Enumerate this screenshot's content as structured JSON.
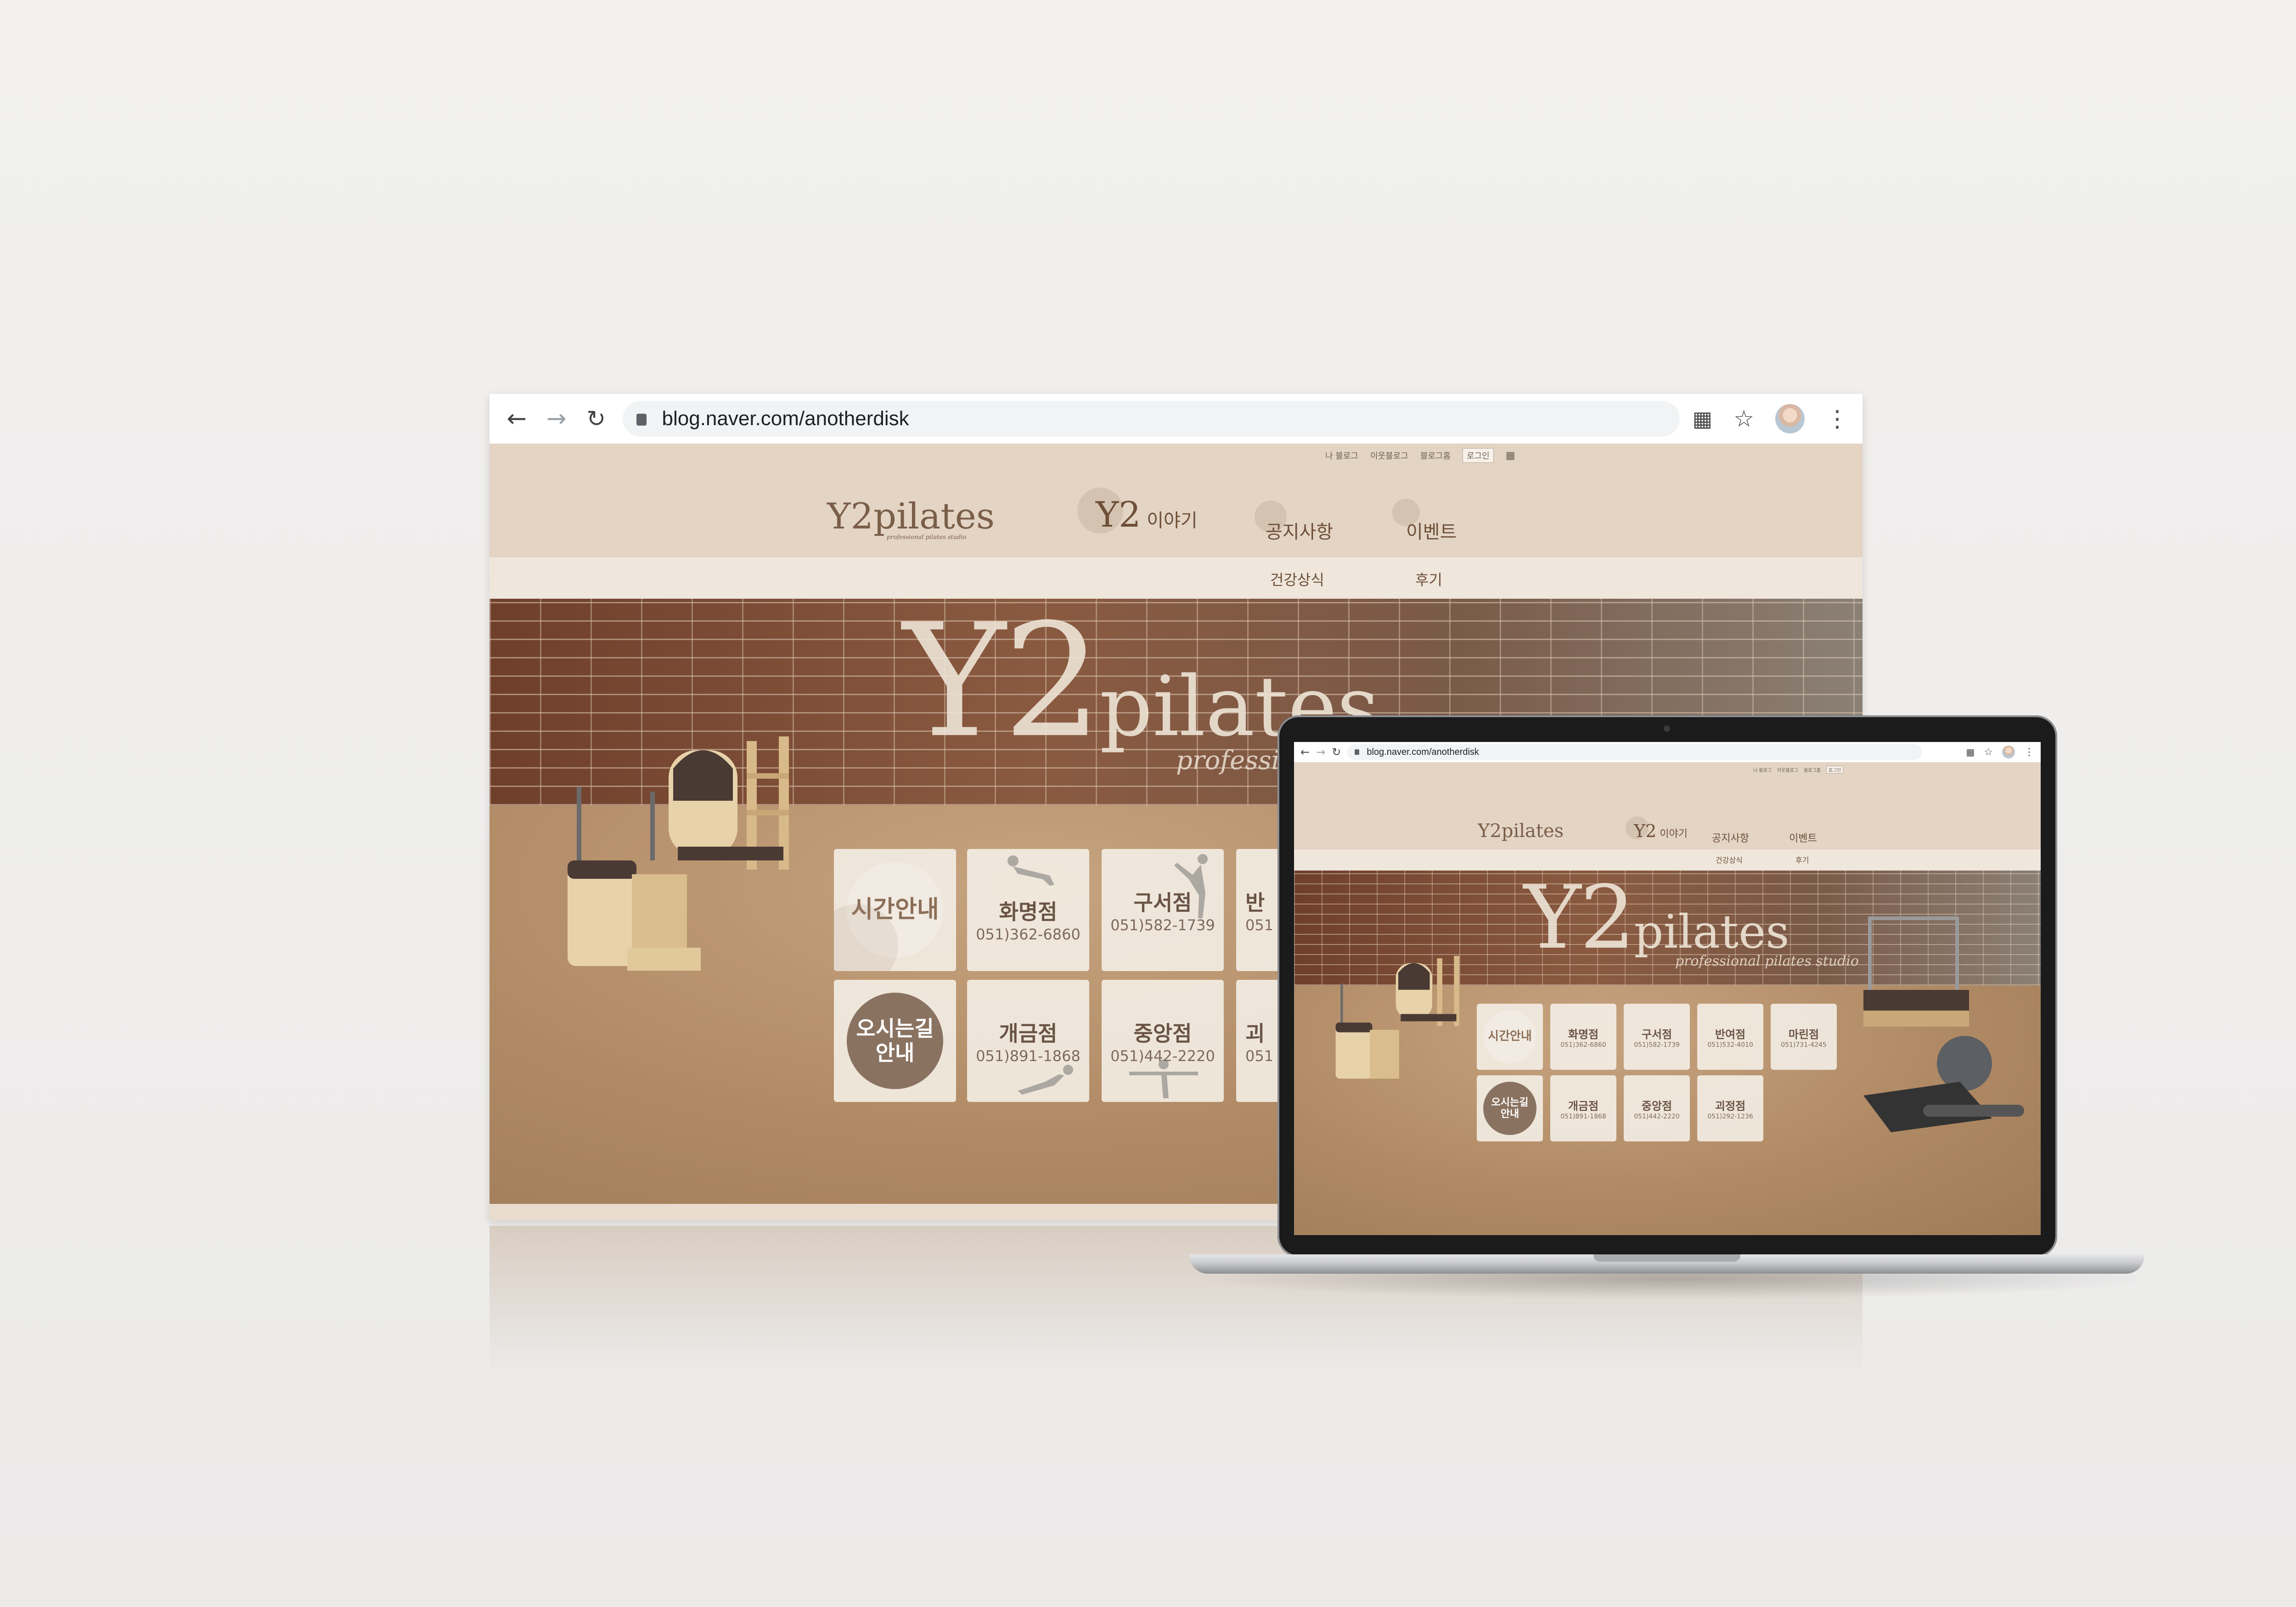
{
  "browser": {
    "url": "blog.naver.com/anotherdisk",
    "icons": [
      "back-icon",
      "forward-icon",
      "reload-icon",
      "lock-icon",
      "extension-icon",
      "star-icon",
      "profile-avatar",
      "more-icon"
    ]
  },
  "utility_nav": {
    "items": [
      "나 블로그",
      "이웃블로그",
      "블로그홈"
    ],
    "login": "로그인"
  },
  "logo": {
    "main": "Y2pilates",
    "tagline": "professional pilates studio"
  },
  "menu": {
    "y2_brand": "Y2",
    "y2_suffix": "이야기",
    "notice": "공지사항",
    "event": "이벤트",
    "sub_health": "건강상식",
    "sub_review": "후기"
  },
  "hero": {
    "title_y2": "Y2",
    "title_pilates": "pilates",
    "subtitle": "professional pilates studio"
  },
  "tiles": {
    "schedule": "시간안내",
    "directions_line1": "오시는길",
    "directions_line2": "안내",
    "branches": [
      {
        "name": "화명점",
        "phone": "051)362-6860"
      },
      {
        "name": "구서점",
        "phone": "051)582-1739"
      },
      {
        "name": "반여점",
        "phone": "051)532-4010"
      },
      {
        "name": "마린점",
        "phone": "051)731-4245"
      },
      {
        "name": "개금점",
        "phone": "051)891-1868"
      },
      {
        "name": "중앙점",
        "phone": "051)442-2220"
      },
      {
        "name": "괴정점",
        "phone": "051)292-1236"
      }
    ],
    "large_partial": {
      "top": "반",
      "top_phone": "051",
      "bottom": "괴",
      "bottom_phone": "051"
    }
  },
  "colors": {
    "header_band": "#e3d4c4",
    "accent_brown": "#6e4f38",
    "dark_circle": "#8a7261",
    "tile_bg": "#f4eee6"
  }
}
